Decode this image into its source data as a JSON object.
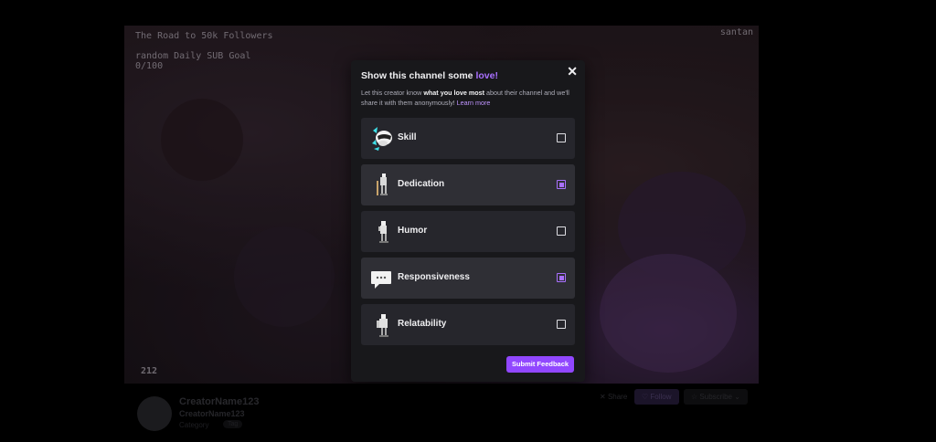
{
  "stream": {
    "overlay_goal_title": "The Road to 50k Followers",
    "overlay_goal2_title": "random Daily SUB Goal",
    "overlay_goal2_count": "0/100",
    "overlay_channel": "santan",
    "overlay_counter": "212"
  },
  "channel": {
    "name": "CreatorName123",
    "subtitle": "CreatorName123",
    "category": "Category",
    "tag": "Tag",
    "share_label": "Share",
    "follow_label": "Follow",
    "subscribe_label": "Subscribe"
  },
  "modal": {
    "title_prefix": "Show this channel some ",
    "title_highlight": "love!",
    "desc_part1": "Let this creator know ",
    "desc_bold": "what you love most",
    "desc_part2": " about their channel and we'll share it with them anonymously! ",
    "learn_more": "Learn more",
    "close_glyph": "✕",
    "options": [
      {
        "label": "Skill",
        "icon": "skill-icon",
        "selected": false
      },
      {
        "label": "Dedication",
        "icon": "dedication-icon",
        "selected": true
      },
      {
        "label": "Humor",
        "icon": "humor-icon",
        "selected": false
      },
      {
        "label": "Responsiveness",
        "icon": "responsiveness-icon",
        "selected": true
      },
      {
        "label": "Relatability",
        "icon": "relatability-icon",
        "selected": false
      }
    ],
    "submit_label": "Submit Feedback"
  },
  "colors": {
    "accent": "#9147ff",
    "accent_light": "#a970ff",
    "modal_bg": "#18181b",
    "option_bg": "#26262c"
  }
}
